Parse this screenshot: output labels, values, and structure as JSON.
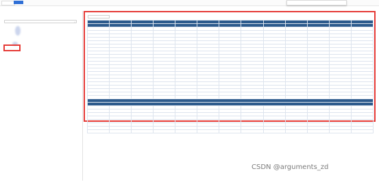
{
  "tabs": [
    "",
    ""
  ],
  "page_title": "",
  "sidebar": {
    "title": "",
    "search_placeholder": "",
    "items": [
      "",
      "",
      "",
      ""
    ]
  },
  "main": {
    "filter_placeholder": "",
    "table": {
      "header_top": [
        "",
        "",
        "",
        "",
        "",
        "",
        "",
        "",
        "",
        "",
        "",
        "",
        ""
      ],
      "header_sub": [
        "",
        "",
        "",
        "",
        "",
        "",
        "",
        "",
        "",
        "",
        "",
        "",
        ""
      ],
      "rows": [
        [
          "",
          "",
          "",
          "",
          "",
          "",
          "",
          "",
          "",
          "",
          "",
          "",
          ""
        ],
        [
          "",
          "",
          "",
          "",
          "",
          "",
          "",
          "",
          "",
          "",
          "",
          "",
          ""
        ],
        [
          "",
          "",
          "",
          "",
          "",
          "",
          "",
          "",
          "",
          "",
          "",
          "",
          ""
        ],
        [
          "",
          "",
          "",
          "",
          "",
          "",
          "",
          "",
          "",
          "",
          "",
          "",
          ""
        ],
        [
          "",
          "",
          "",
          "",
          "",
          "",
          "",
          "",
          "",
          "",
          "",
          "",
          ""
        ],
        [
          "",
          "",
          "",
          "",
          "",
          "",
          "",
          "",
          "",
          "",
          "",
          "",
          ""
        ],
        [
          "",
          "",
          "",
          "",
          "",
          "",
          "",
          "",
          "",
          "",
          "",
          "",
          ""
        ],
        [
          "",
          "",
          "",
          "",
          "",
          "",
          "",
          "",
          "",
          "",
          "",
          "",
          ""
        ],
        [
          "",
          "",
          "",
          "",
          "",
          "",
          "",
          "",
          "",
          "",
          "",
          "",
          ""
        ],
        [
          "",
          "",
          "",
          "",
          "",
          "",
          "",
          "",
          "",
          "",
          "",
          "",
          ""
        ],
        [
          "",
          "",
          "",
          "",
          "",
          "",
          "",
          "",
          "",
          "",
          "",
          "",
          ""
        ],
        [
          "",
          "",
          "",
          "",
          "",
          "",
          "",
          "",
          "",
          "",
          "",
          "",
          ""
        ],
        [
          "",
          "",
          "",
          "",
          "",
          "",
          "",
          "",
          "",
          "",
          "",
          "",
          ""
        ],
        [
          "",
          "",
          "",
          "",
          "",
          "",
          "",
          "",
          "",
          "",
          "",
          "",
          ""
        ],
        [
          "",
          "",
          "",
          "",
          "",
          "",
          "",
          "",
          "",
          "",
          "",
          "",
          ""
        ],
        [
          "",
          "",
          "",
          "",
          "",
          "",
          "",
          "",
          "",
          "",
          "",
          "",
          ""
        ],
        [
          "",
          "",
          "",
          "",
          "",
          "",
          "",
          "",
          "",
          "",
          "",
          "",
          ""
        ],
        [
          "",
          "",
          "",
          "",
          "",
          "",
          "",
          "",
          "",
          "",
          "",
          "",
          ""
        ],
        [
          "",
          "",
          "",
          "",
          "",
          "",
          "",
          "",
          "",
          "",
          "",
          "",
          ""
        ],
        [
          "",
          "",
          "",
          "",
          "",
          "",
          "",
          "",
          "",
          "",
          "",
          "",
          ""
        ],
        [
          "",
          "",
          "",
          "",
          "",
          "",
          "",
          "",
          "",
          "",
          "",
          "",
          ""
        ]
      ],
      "group_rows": [
        "",
        ""
      ],
      "tail_rows": [
        [
          "",
          "",
          "",
          "",
          "",
          "",
          "",
          "",
          "",
          "",
          "",
          "",
          ""
        ],
        [
          "",
          "",
          "",
          "",
          "",
          "",
          "",
          "",
          "",
          "",
          "",
          "",
          ""
        ],
        [
          "",
          "",
          "",
          "",
          "",
          "",
          "",
          "",
          "",
          "",
          "",
          "",
          ""
        ],
        [
          "",
          "",
          "",
          "",
          "",
          "",
          "",
          "",
          "",
          "",
          "",
          "",
          ""
        ],
        [
          "",
          "",
          "",
          "",
          "",
          "",
          "",
          "",
          "",
          "",
          "",
          "",
          ""
        ],
        [
          "",
          "",
          "",
          "",
          "",
          "",
          "",
          "",
          "",
          "",
          "",
          "",
          ""
        ],
        [
          "",
          "",
          "",
          "",
          "",
          "",
          "",
          "",
          "",
          "",
          "",
          "",
          ""
        ],
        [
          "",
          "",
          "",
          "",
          "",
          "",
          "",
          "",
          "",
          "",
          "",
          "",
          ""
        ]
      ]
    }
  },
  "watermark": "CSDN @arguments_zd",
  "colors": {
    "header": "#2c5a8c",
    "accent": "#2f6fd6",
    "highlight": "#e53935"
  }
}
